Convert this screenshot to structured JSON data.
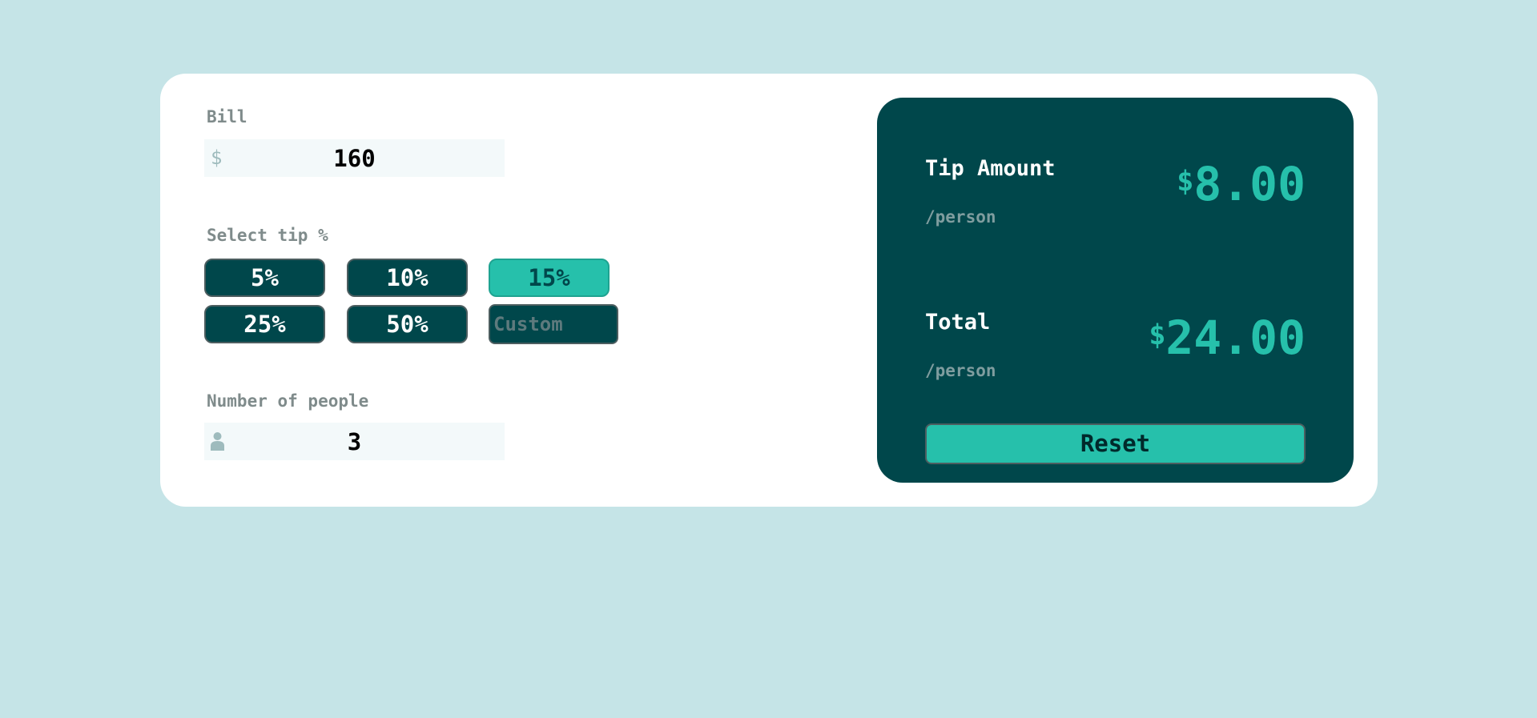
{
  "colors": {
    "background": "#c5e4e7",
    "card": "#ffffff",
    "dark_teal": "#00474b",
    "accent": "#26c0ab",
    "label_gray": "#7f8b8b",
    "field_bg": "#f3f9fa"
  },
  "bill": {
    "label": "Bill",
    "prefix": "$",
    "value": "160"
  },
  "tip": {
    "label": "Select tip %",
    "options": [
      "5%",
      "10%",
      "15%",
      "25%",
      "50%"
    ],
    "selected": "15%",
    "custom_placeholder": "Custom"
  },
  "people": {
    "label": "Number of people",
    "icon": "person-icon",
    "value": "3"
  },
  "results": {
    "tip_amount": {
      "title": "Tip Amount",
      "sub": "/person",
      "currency": "$",
      "value": "8.00"
    },
    "total": {
      "title": "Total",
      "sub": "/person",
      "currency": "$",
      "value": "24.00"
    },
    "reset_label": "Reset"
  }
}
